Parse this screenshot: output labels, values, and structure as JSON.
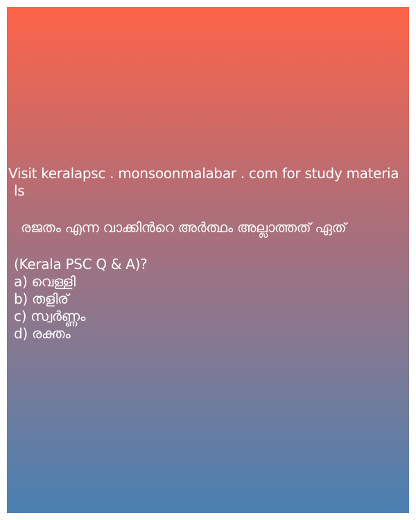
{
  "promo": {
    "line1": "Visit keralapsc . monsoonmalabar . com for study materia",
    "line2": "ls"
  },
  "question": {
    "text": "രജതം എന്ന വാക്കിൻറെ അർത്ഥം അല്ലാത്തത് ഏത്",
    "source": "(Kerala PSC Q & A)?"
  },
  "options": [
    {
      "label": "a) വെള്ളി"
    },
    {
      "label": "b) തളിര്"
    },
    {
      "label": "c) സ്വർണ്ണം"
    },
    {
      "label": "d) രക്തം"
    }
  ],
  "colors": {
    "gradient_top": "#fe6449",
    "gradient_bottom": "#4a80b2",
    "text": "#ffffff"
  }
}
